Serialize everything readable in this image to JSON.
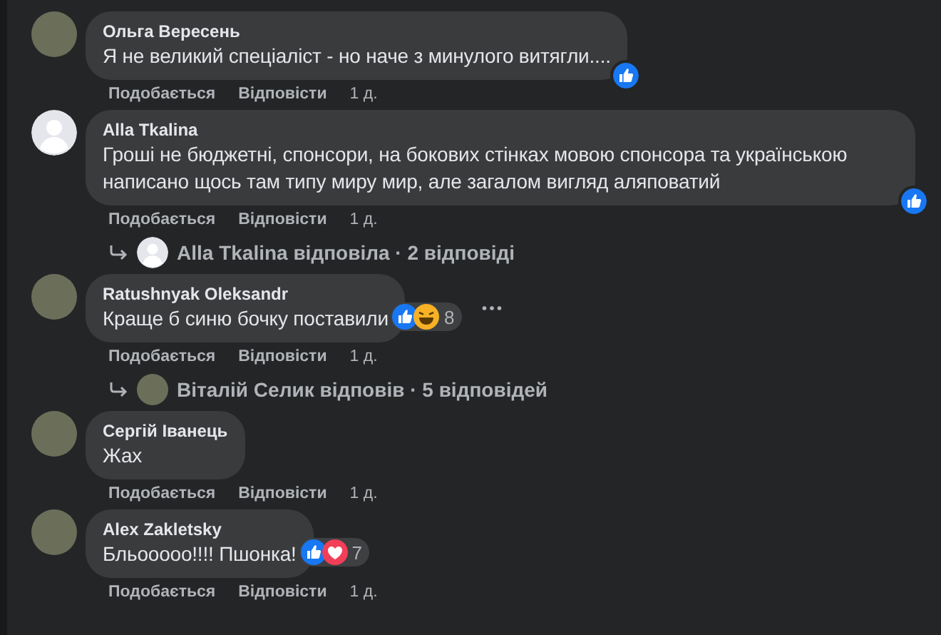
{
  "comments": [
    {
      "author": "Ольга Вересень",
      "avatar": {
        "kind": "photo"
      },
      "text": "Я не великий спеціаліст - но наче з минулого витягли....",
      "reactions": [
        {
          "kind": "like"
        }
      ],
      "actions": [
        "Подобається",
        "Відповісти"
      ],
      "time": "1 д."
    },
    {
      "author": "Alla Tkalina",
      "avatar": {
        "kind": "silhouette"
      },
      "text": "Гроші не бюджетні, спонсори, на бокових стінках мовою спонсора та українською написано щось там типу миру мир, але загалом вигляд аляповатий",
      "reactions": [
        {
          "kind": "like"
        }
      ],
      "actions": [
        "Подобається",
        "Відповісти"
      ],
      "time": "1 д.",
      "reply_summary": {
        "avatar": {
          "kind": "silhouette"
        },
        "text": "Alla Tkalina відповіла · 2 відповіді"
      }
    },
    {
      "author": "Ratushnyak Oleksandr",
      "avatar": {
        "kind": "photo"
      },
      "text": "Краще б синю бочку поставили",
      "reactions": [
        {
          "kind": "like"
        },
        {
          "kind": "haha"
        }
      ],
      "reaction_count": "8",
      "menu": true,
      "actions": [
        "Подобається",
        "Відповісти"
      ],
      "time": "1 д.",
      "reply_summary": {
        "avatar": {
          "kind": "photo"
        },
        "text": "Віталій Селик відповів · 5 відповідей"
      }
    },
    {
      "author": "Сергій Іванець",
      "avatar": {
        "kind": "photo"
      },
      "text": "Жах",
      "actions": [
        "Подобається",
        "Відповісти"
      ],
      "time": "1 д."
    },
    {
      "author": "Alex Zakletsky",
      "avatar": {
        "kind": "photo"
      },
      "text": "Бльоoooo!!!! Пшонка!",
      "reactions": [
        {
          "kind": "like"
        },
        {
          "kind": "love"
        }
      ],
      "reaction_count": "7",
      "actions": [
        "Подобається",
        "Відповісти"
      ],
      "time": "1 д."
    }
  ]
}
